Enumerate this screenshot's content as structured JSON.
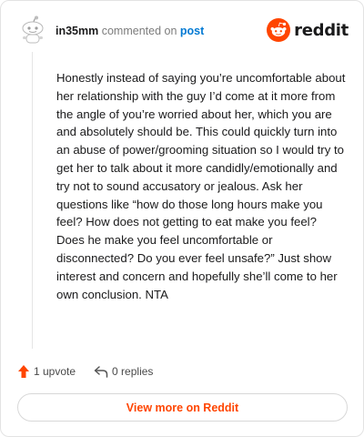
{
  "comment": {
    "username": "in35mm",
    "commented_text": "commented on",
    "post_link": "post",
    "body": "Honestly instead of saying you’re uncomfortable about her relationship with the guy I’d come at it more from the angle of you’re worried about her, which you are and absolutely should be. This could quickly turn into an abuse of power/grooming situation so I would try to get her to talk about it more candidly/emotionally and try not to sound accusatory or jealous. Ask her questions like “how do those long hours make you feel? How does not getting to eat make you feel? Does he make you feel uncomfortable or disconnected? Do you ever feel unsafe?” Just show interest and concern and hopefully she’ll come to her own conclusion. NTA"
  },
  "logo": {
    "wordmark": "reddit",
    "icon": "reddit-logo-icon",
    "color": "#ff4500"
  },
  "actions": {
    "upvote_label": "1 upvote",
    "upvote_icon": "upvote-arrow-icon",
    "upvote_color": "#ff4500",
    "replies_label": "0 replies",
    "replies_icon": "reply-icon"
  },
  "view_more": {
    "label": "View more on Reddit",
    "color": "#ff4500"
  }
}
